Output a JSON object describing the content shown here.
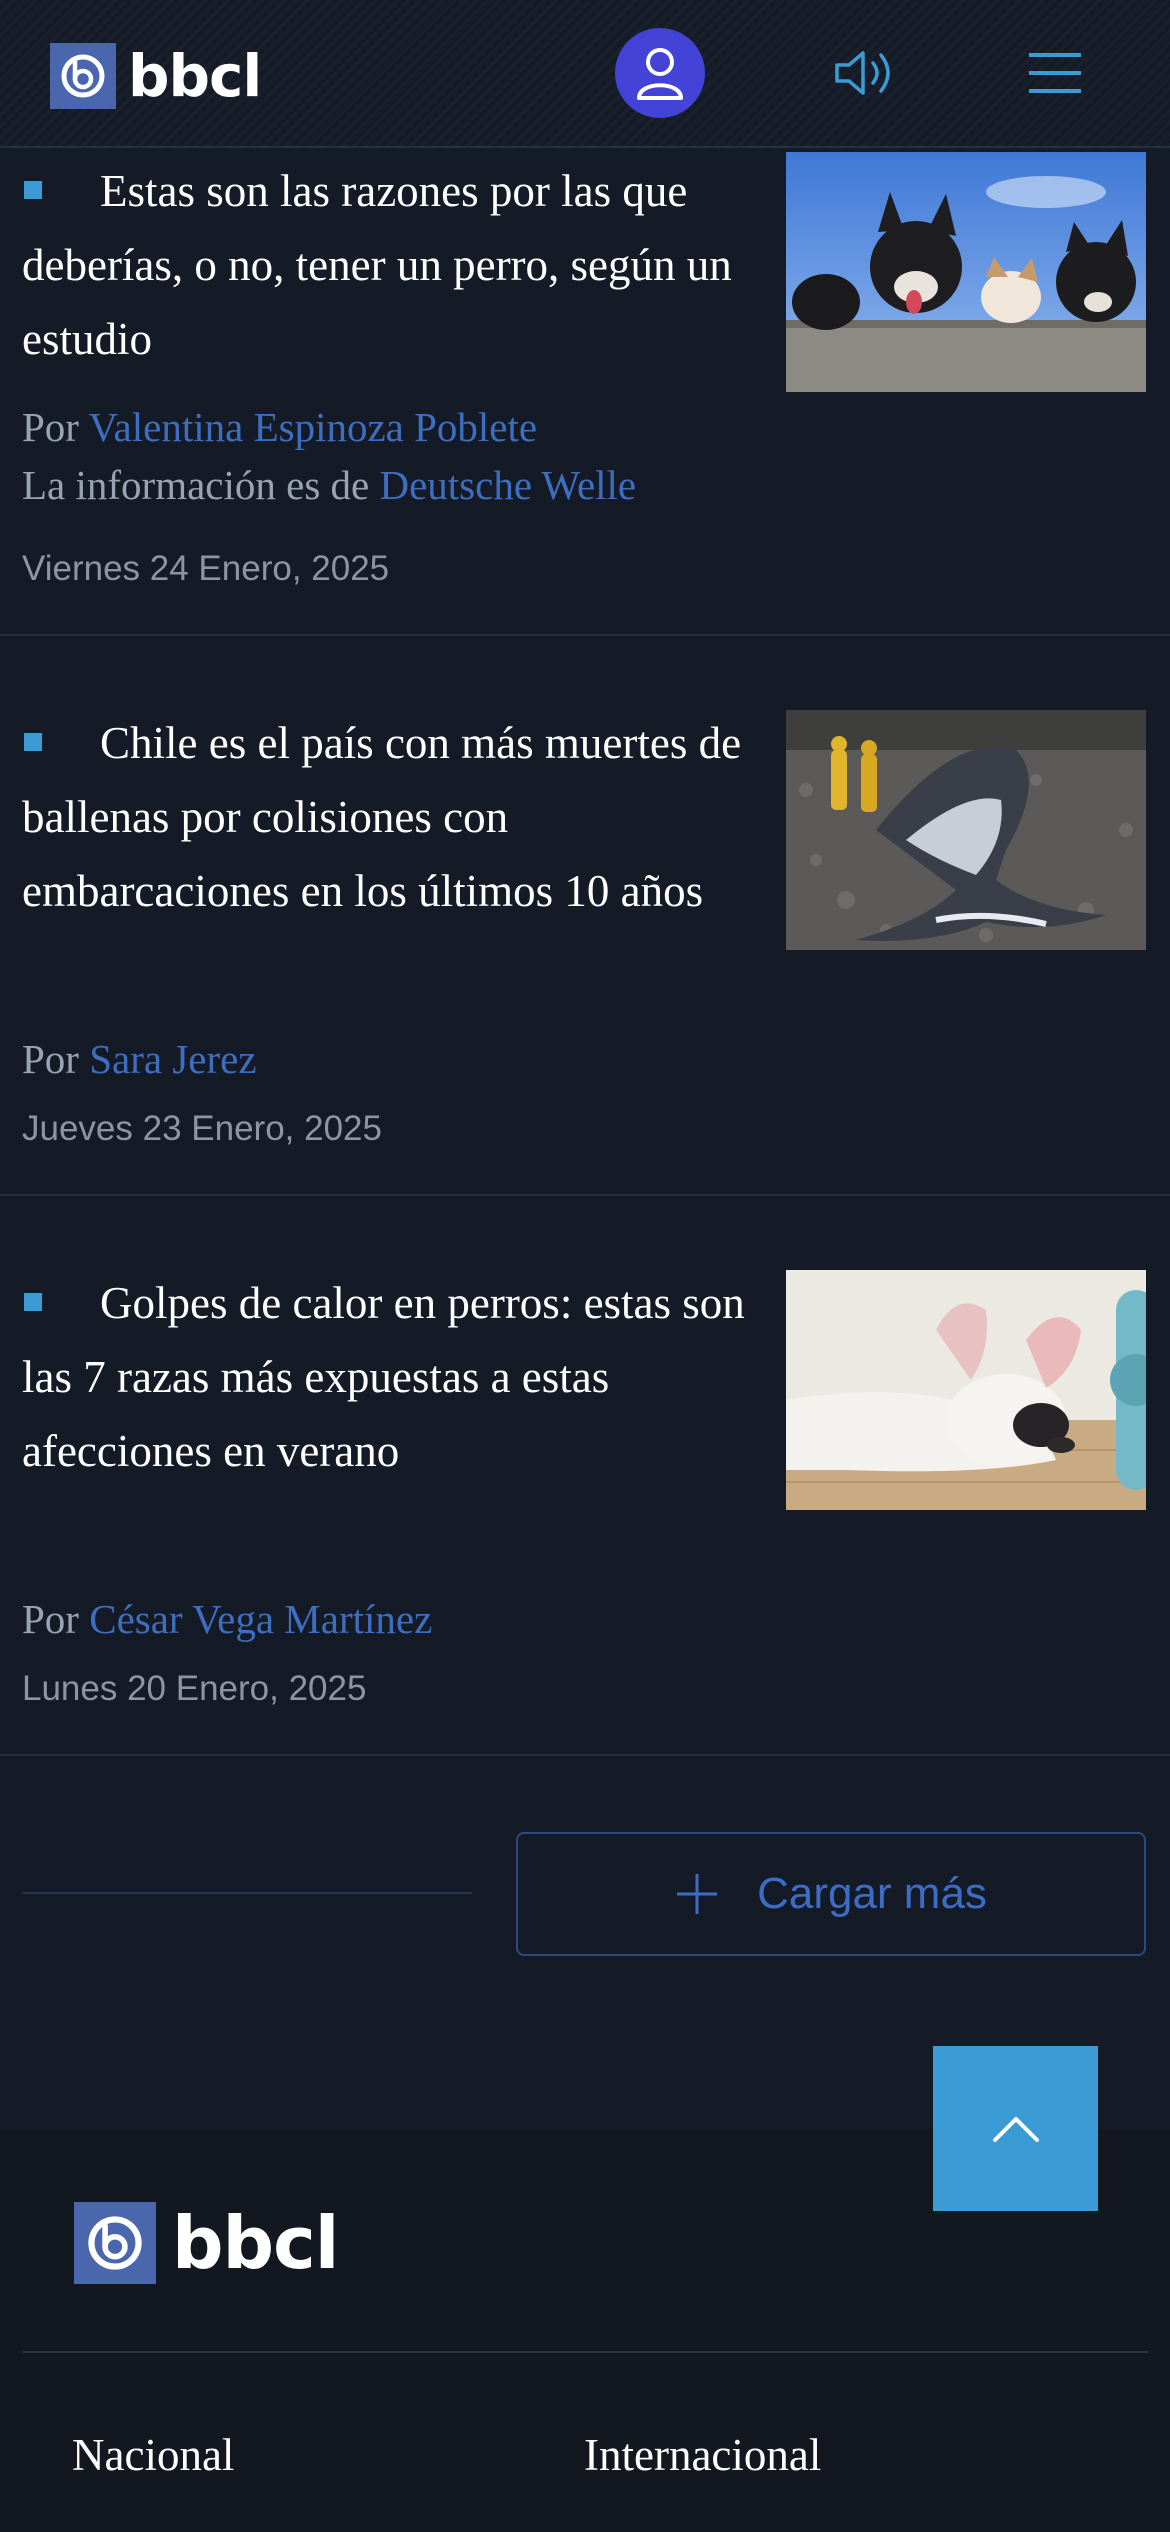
{
  "header": {
    "logo_text": "bbcl",
    "user_icon": "user-icon",
    "audio_icon": "speaker-icon",
    "menu_icon": "hamburger-menu-icon"
  },
  "articles": [
    {
      "title": "Estas son las razones por las que deberías, o no, tener un perro, según un estudio",
      "by_prefix": "Por",
      "author": "Valentina Espinoza Poblete",
      "source_prefix": "La información es de",
      "source": "Deutsche Welle",
      "date": "Viernes 24 Enero, 2025"
    },
    {
      "title": "Chile es el país con más muertes de ballenas por colisiones con embarcaciones en los últimos 10 años",
      "by_prefix": "Por",
      "author": "Sara Jerez",
      "date": "Jueves 23 Enero, 2025"
    },
    {
      "title": "Golpes de calor en perros: estas son las 7 razas más expuestas a estas afecciones en verano",
      "by_prefix": "Por",
      "author": "César Vega Martínez",
      "date": "Lunes 20 Enero, 2025"
    }
  ],
  "load_more": {
    "label": "Cargar más",
    "icon": "plus-icon"
  },
  "scroll_top_icon": "chevron-up-icon",
  "footer": {
    "logo_text": "bbcl",
    "links": [
      "Nacional",
      "Internacional"
    ]
  },
  "colors": {
    "background": "#141b26",
    "accent_blue": "#3b9bd4",
    "link_blue": "#3e6ec0",
    "user_button": "#4343d8"
  }
}
